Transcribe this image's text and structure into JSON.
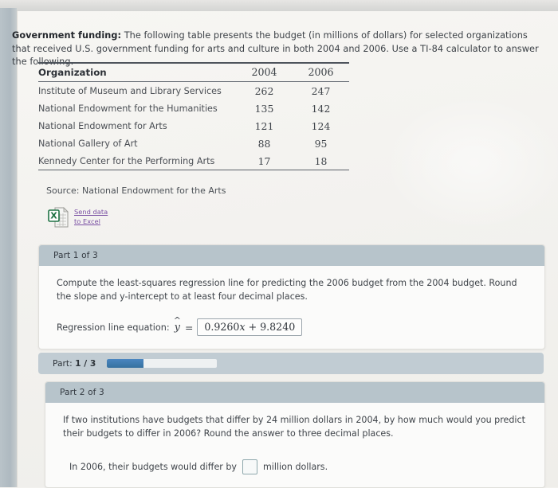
{
  "intro": {
    "lead": "Government funding:",
    "body": " The following table presents the budget (in millions of dollars) for selected organizations that received U.S. government funding for arts and culture in both 2004 and 2006. Use a TI-84 calculator to answer the following."
  },
  "table": {
    "headers": [
      "Organization",
      "2004",
      "2006"
    ],
    "rows": [
      [
        "Institute of Museum and Library Services",
        "262",
        "247"
      ],
      [
        "National Endowment for the Humanities",
        "135",
        "142"
      ],
      [
        "National Endowment for Arts",
        "121",
        "124"
      ],
      [
        "National Gallery of Art",
        "88",
        "95"
      ],
      [
        "Kennedy Center for the Performing Arts",
        "17",
        "18"
      ]
    ]
  },
  "source": "Source: National Endowment for the Arts",
  "excel_link": {
    "icon": "excel-spreadsheet-icon",
    "line1": "Send data",
    "line2": "to Excel"
  },
  "part1": {
    "header": "Part 1 of 3",
    "question": "Compute the least-squares regression line for predicting the 2006 budget from the 2004 budget. Round the slope and y-intercept to at least four decimal places.",
    "equation_label": "Regression line equation:",
    "yhat": "y",
    "hat": "^",
    "equals": "=",
    "value": "0.9260x + 9.8240",
    "value_coefficient": "0.9260",
    "value_variable": "x",
    "value_operator": "+",
    "value_intercept": "9.8240"
  },
  "progress": {
    "label_prefix": "Part:",
    "label_value": "1 / 3",
    "percent": 33
  },
  "part2": {
    "header": "Part 2 of 3",
    "question": "If two institutions have budgets that differ by 24 million dollars in 2004, by how much would you predict their budgets to differ in 2006? Round the answer to three decimal places.",
    "answer_prefix": "In 2006, their budgets would differ by",
    "answer_value": "",
    "answer_suffix": "million dollars."
  },
  "colors": {
    "header_band": "#b7c4cb",
    "progress_fill": "#3d7ab8",
    "link": "#7a4fa3",
    "excel_green": "#1f7244"
  }
}
